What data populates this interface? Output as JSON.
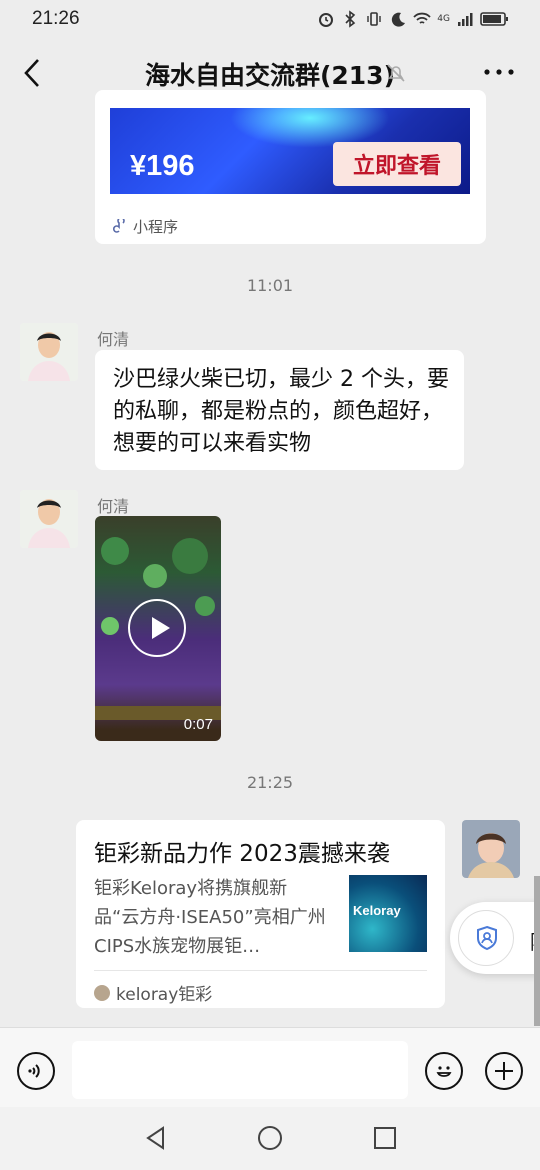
{
  "status_bar": {
    "time": "21:26",
    "network": "4G"
  },
  "header": {
    "title": "海水自由交流群(213)"
  },
  "mini_program_card": {
    "price": "¥196",
    "button": "立即查看",
    "label": "小程序"
  },
  "timestamps": [
    "11:01",
    "21:25"
  ],
  "messages": [
    {
      "sender": "何清",
      "text": "沙巴绿火柴已切，最少 2 个头，要的私聊，都是粉点的，颜色超好，想要的可以来看实物"
    },
    {
      "sender": "何清",
      "video_duration": "0:07"
    }
  ],
  "article_card": {
    "title": "钜彩新品力作 2023震撼来袭",
    "description": "钜彩Keloray将携旗舰新品“云方舟·ISEA50”亮相广州CIPS水族宠物展钜…",
    "thumb_brand": "Keloray",
    "source": "keloray钜彩"
  },
  "floating_widget": {
    "text": "除"
  },
  "colors": {
    "background": "#ededed",
    "bubble": "#ffffff",
    "buy_button_text": "#c0152a"
  }
}
